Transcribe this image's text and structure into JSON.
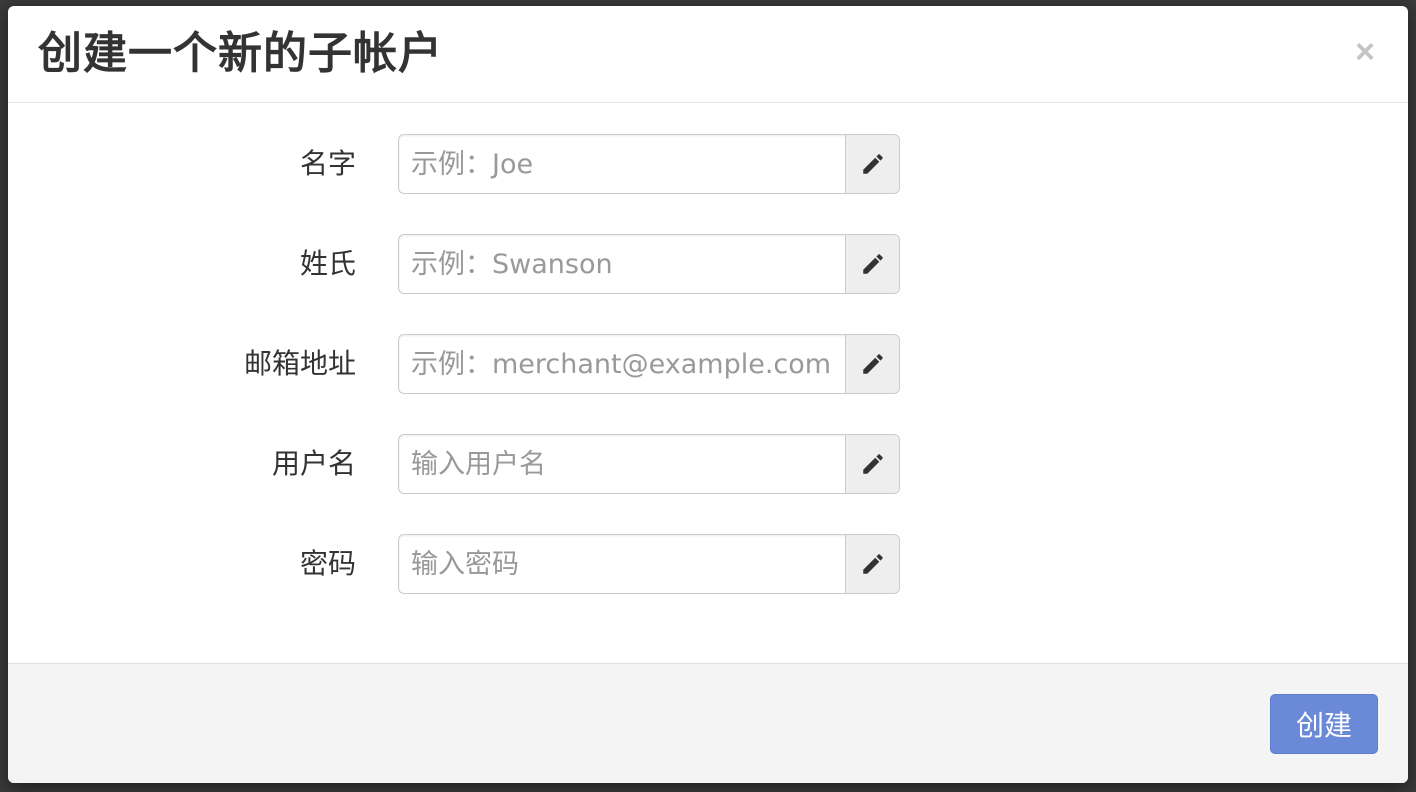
{
  "modal": {
    "title": "创建一个新的子帐户",
    "close_glyph": "×"
  },
  "form": {
    "fields": [
      {
        "label": "名字",
        "value": "",
        "placeholder": "示例：Joe",
        "icon": "pencil-icon"
      },
      {
        "label": "姓氏",
        "value": "",
        "placeholder": "示例：Swanson",
        "icon": "pencil-icon"
      },
      {
        "label": "邮箱地址",
        "value": "",
        "placeholder": "示例：merchant@example.com",
        "icon": "pencil-icon"
      },
      {
        "label": "用户名",
        "value": "",
        "placeholder": "输入用户名",
        "icon": "pencil-icon"
      },
      {
        "label": "密码",
        "value": "",
        "placeholder": "输入密码",
        "icon": "pencil-icon"
      }
    ]
  },
  "footer": {
    "create_label": "创建"
  },
  "colors": {
    "primary_button": "#6a8ad8",
    "title_text": "#333333",
    "placeholder_text": "#999999",
    "addon_background": "#eeeeee",
    "footer_background": "#f4f4f4"
  }
}
